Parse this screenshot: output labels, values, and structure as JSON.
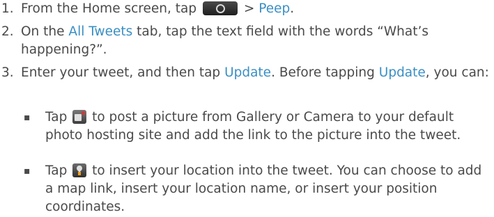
{
  "steps": [
    {
      "number": "1.",
      "before": "From the Home screen, tap",
      "icon": "home-screen-app-icon",
      "gt": ">",
      "app": "Peep",
      "after": "."
    },
    {
      "number": "2.",
      "before": "On the",
      "tab": "All Tweets",
      "after": "tab, tap the text field with the words “What’s happening?”."
    },
    {
      "number": "3.",
      "before": "Enter your tweet, and then tap",
      "update1": "Update",
      "middle": ". Before tapping",
      "update2": "Update",
      "after": ", you can:"
    }
  ],
  "bullets": [
    {
      "marker": "▪",
      "before": "Tap",
      "icon": "camera-icon",
      "after": "to post a picture from Gallery or Camera to your default photo hosting site and add the link to the picture into the tweet."
    },
    {
      "marker": "▪",
      "before": "Tap",
      "icon": "location-icon",
      "after": "to insert your location into the tweet. You can choose to add a map link, insert your location name, or insert your position coordinates."
    }
  ],
  "colors": {
    "text": "#4a4a4a",
    "accent": "#3a8fc4"
  }
}
